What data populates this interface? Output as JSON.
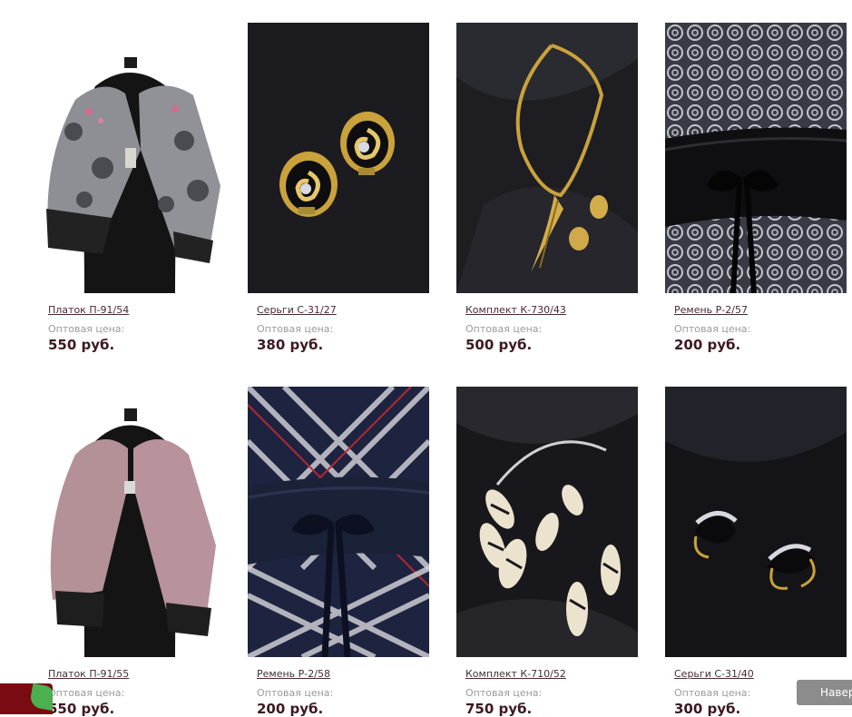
{
  "products": [
    {
      "name": "Платок П-91/54",
      "price_label": "Оптовая цена:",
      "price": "550 руб.",
      "image": "scarf-gray-mannequin"
    },
    {
      "name": "Серьги С-31/27",
      "price_label": "Оптовая цена:",
      "price": "380 руб.",
      "image": "gold-black-earrings"
    },
    {
      "name": "Комплект К-730/43",
      "price_label": "Оптовая цена:",
      "price": "500 руб.",
      "image": "gold-necklace-set"
    },
    {
      "name": "Ремень Р-2/57",
      "price_label": "Оптовая цена:",
      "price": "200 руб.",
      "image": "black-belt-pattern"
    },
    {
      "name": "Платок П-91/55",
      "price_label": "Оптовая цена:",
      "price": "550 руб.",
      "image": "scarf-pink-mannequin"
    },
    {
      "name": "Ремень Р-2/58",
      "price_label": "Оптовая цена:",
      "price": "200 руб.",
      "image": "navy-belt-plaid"
    },
    {
      "name": "Комплект К-710/52",
      "price_label": "Оптовая цена:",
      "price": "750 руб.",
      "image": "zebra-jewelry-set"
    },
    {
      "name": "Серьги С-31/40",
      "price_label": "Оптовая цена:",
      "price": "300 руб.",
      "image": "gold-crystal-earrings"
    }
  ],
  "scroll_top_button": {
    "label": "Наверх",
    "icon": "up-arrow-tab"
  },
  "corner_widget": {
    "icon": "leaf-icon"
  },
  "colors": {
    "price": "#3e1822",
    "link": "#4a2a33",
    "muted": "#9a9a9a",
    "badge": "#7a0b12"
  }
}
